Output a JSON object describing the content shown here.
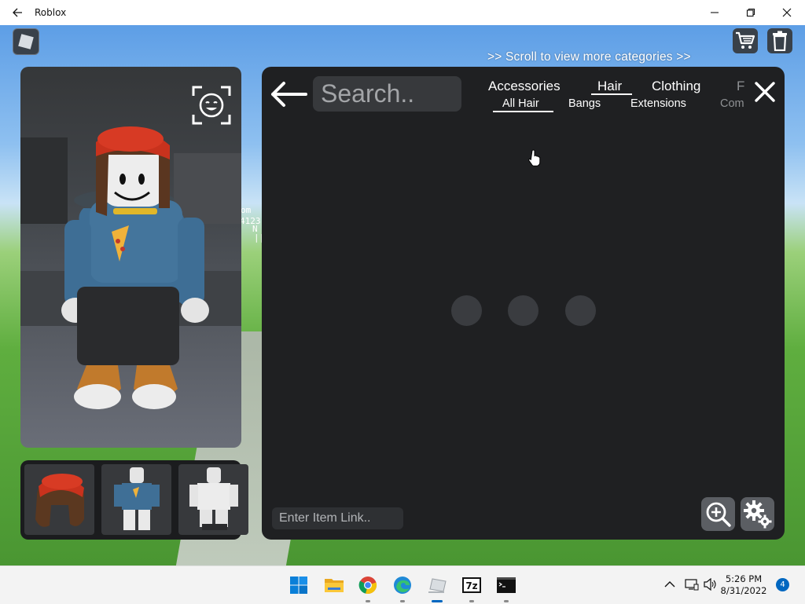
{
  "window": {
    "title": "Roblox",
    "controls": [
      "minimize-icon",
      "restore-icon",
      "close-icon"
    ]
  },
  "hud": {
    "scroll_hint": ">> Scroll to view more categories >>",
    "shop_icon": "cart-icon",
    "trash_icon": "trash-icon",
    "background_text": [
      "om",
      "4123",
      "N",
      "||"
    ]
  },
  "preview": {
    "emote_icon": "face-scan-icon"
  },
  "outfits": [
    {
      "name": "red-beanie-hair"
    },
    {
      "name": "pizza-shirt-avatar"
    },
    {
      "name": "white-avatar"
    }
  ],
  "editor": {
    "search_placeholder": "Search..",
    "categories": [
      {
        "label": "Accessories",
        "active": false
      },
      {
        "label": "Hair",
        "active": true
      },
      {
        "label": "Clothing",
        "active": false
      },
      {
        "label": "F",
        "active": false
      }
    ],
    "subcategories": [
      {
        "label": "All Hair",
        "active": true
      },
      {
        "label": "Bangs",
        "active": false
      },
      {
        "label": "Extensions",
        "active": false
      },
      {
        "label": "Com",
        "active": false
      }
    ],
    "item_link_placeholder": "Enter Item Link..",
    "loading_dots": 3
  },
  "taskbar": {
    "apps": [
      "windows-start-icon",
      "file-explorer-icon",
      "chrome-icon",
      "edge-icon",
      "roblox-icon",
      "7zip-icon",
      "terminal-icon"
    ],
    "time": "5:26 PM",
    "date": "8/31/2022",
    "notification_count": "4",
    "seven_zip_label": "7z"
  },
  "colors": {
    "panel": "#1f2022",
    "accent": "#0067c0",
    "search_bg": "#37393c"
  }
}
